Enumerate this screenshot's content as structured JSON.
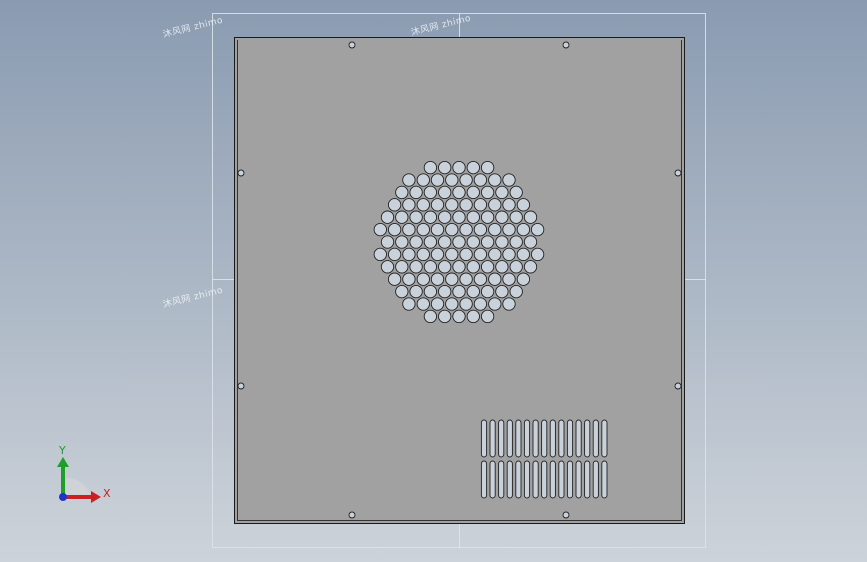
{
  "watermarks": [
    "沐风网 zhimo",
    "沐风网 zhimo",
    "沐风网 zhimo"
  ],
  "triad": {
    "x_label": "X",
    "y_label": "Y",
    "x_color": "#cc1f1f",
    "y_color": "#1f9e2a",
    "z_color": "#1f35c9"
  },
  "colors": {
    "plate": "#a1a1a1",
    "hole_fill": "#c9d1da",
    "slot_fill": "#c9d1da"
  }
}
